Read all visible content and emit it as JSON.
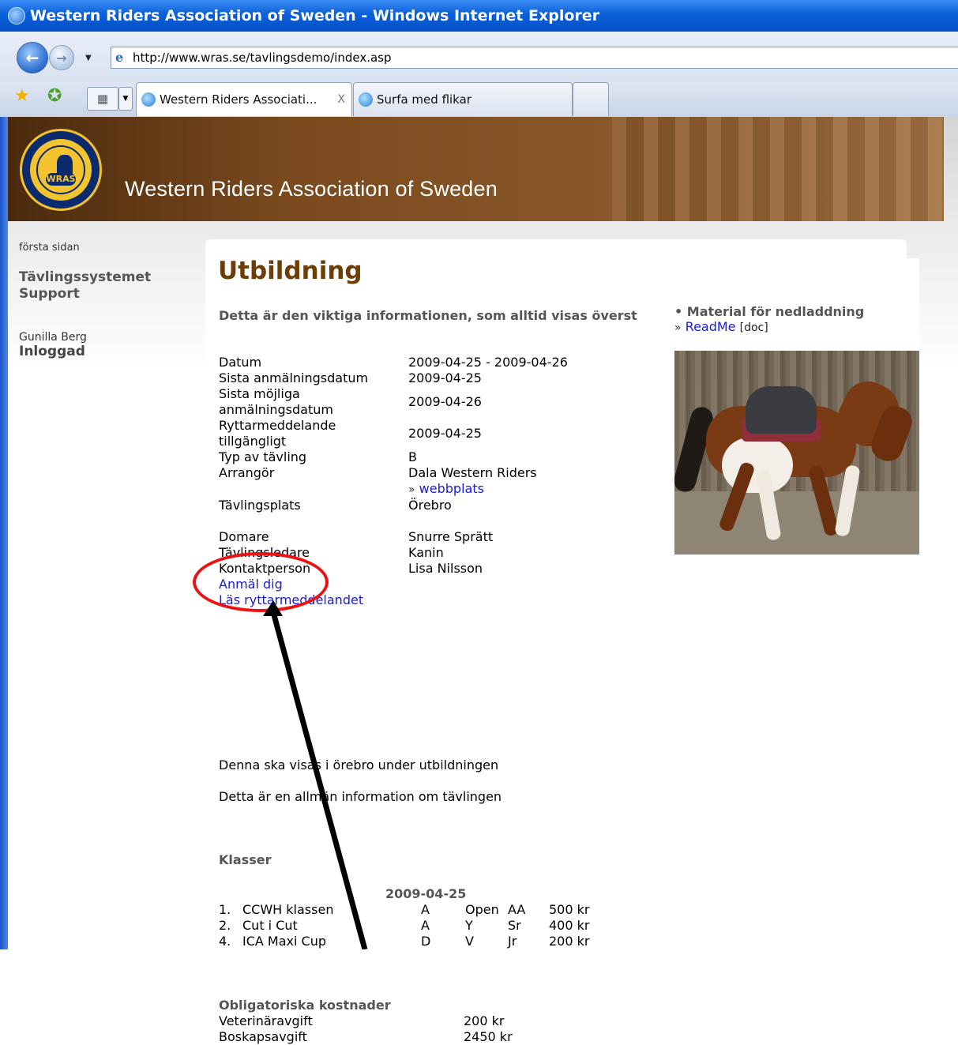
{
  "window": {
    "title": "Western Riders Association of Sweden - Windows Internet Explorer"
  },
  "address_bar": {
    "url": "http://www.wras.se/tavlingsdemo/index.asp"
  },
  "tabs": [
    {
      "label": "Western Riders Associati...",
      "close": "X"
    },
    {
      "label": "Surfa med flikar"
    }
  ],
  "banner": {
    "title": "Western Riders Association of Sweden",
    "logo_text": "WRAS"
  },
  "sidebar": {
    "first_page": "första sidan",
    "system_line1": "Tävlingssystemet",
    "system_line2": "Support",
    "user_name": "Gunilla Berg",
    "user_status": "Inloggad"
  },
  "main": {
    "heading": "Utbildning",
    "intro": "Detta är den viktiga informationen, som alltid visas överst",
    "details": [
      {
        "label": "Datum",
        "value": "2009-04-25 - 2009-04-26"
      },
      {
        "label": "Sista anmälningsdatum",
        "value": "2009-04-25"
      },
      {
        "label": "Sista möjliga anmälningsdatum",
        "value": "2009-04-26"
      },
      {
        "label": "Ryttarmeddelande tillgängligt",
        "value": "2009-04-25"
      },
      {
        "label": "Typ av tävling",
        "value": "B"
      },
      {
        "label": "Arrangör",
        "value": "Dala Western Riders"
      },
      {
        "label": "Tävlingsplats",
        "value": "Örebro"
      },
      {
        "label": "Domare",
        "value": "Snurre Sprätt"
      },
      {
        "label": "Tävlingsledare",
        "value": "Kanin"
      },
      {
        "label": "Kontaktperson",
        "value": "Lisa Nilsson"
      }
    ],
    "website_link": "webbplats",
    "link_arrow": "»",
    "register_link": "Anmäl dig",
    "rider_message_link": "Läs ryttarmeddelandet",
    "para1": "Denna ska visas i örebro under utbildningen",
    "para2": "Detta är en allmän information om tävlingen",
    "classes_heading": "Klasser",
    "classes_date": "2009-04-25",
    "classes": [
      {
        "num": "1.",
        "name": "CCWH klassen",
        "a": "A",
        "b": "Open",
        "c": "AA",
        "price": "500 kr"
      },
      {
        "num": "2.",
        "name": "Cut i Cut",
        "a": "A",
        "b": "Y",
        "c": "Sr",
        "price": "400 kr"
      },
      {
        "num": "4.",
        "name": "ICA Maxi Cup",
        "a": "D",
        "b": "V",
        "c": "Jr",
        "price": "200 kr"
      }
    ],
    "costs_heading": "Obligatoriska kostnader",
    "costs": [
      {
        "label": "Veterinäravgift",
        "value": "200 kr"
      },
      {
        "label": "Boskapsavgift",
        "value": "2450 kr"
      }
    ]
  },
  "right": {
    "material_heading": "• Material för nedladdning",
    "readme_link": "ReadMe",
    "readme_type": "[doc]"
  },
  "colors": {
    "heading": "#6e3d06",
    "link": "#1a1adb",
    "annotation": "#e11111"
  }
}
